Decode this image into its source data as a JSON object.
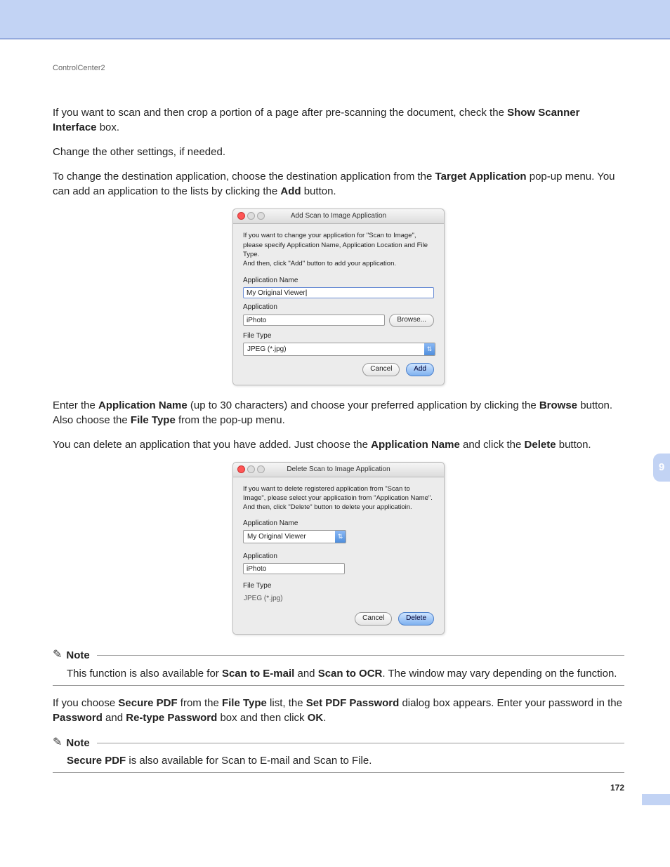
{
  "header": {
    "title": "ControlCenter2"
  },
  "chapter_tab": "9",
  "page_number": "172",
  "para1": {
    "t1": "If you want to scan and then crop a portion of a page after pre-scanning the document, check the ",
    "b1": "Show Scanner Interface",
    "t2": " box."
  },
  "para2": "Change the other settings, if needed.",
  "para3": {
    "t1": "To change the destination application, choose the destination application from the ",
    "b1": "Target Application",
    "t2": " pop-up menu. You can add an application to the lists by clicking the ",
    "b2": "Add",
    "t3": " button."
  },
  "dlg1": {
    "title": "Add Scan to Image Application",
    "instr": "If you want to change your application for \"Scan to Image\", please specify Application Name, Application Location and File Type.\nAnd then, click \"Add\" button to add your application.",
    "appname_label": "Application Name",
    "appname_value": "My Original Viewer",
    "app_label": "Application",
    "app_value": "iPhoto",
    "browse": "Browse...",
    "filetype_label": "File Type",
    "filetype_value": "JPEG (*.jpg)",
    "cancel": "Cancel",
    "add": "Add"
  },
  "para4": {
    "t1": "Enter the ",
    "b1": "Application Name",
    "t2": " (up to 30 characters) and choose your preferred application by clicking the ",
    "b2": "Browse",
    "t3": " button. Also choose the ",
    "b3": "File Type",
    "t4": " from the pop-up menu."
  },
  "para5": {
    "t1": "You can delete an application that you have added. Just choose the ",
    "b1": "Application Name",
    "t2": " and click the ",
    "b2": "Delete",
    "t3": " button."
  },
  "dlg2": {
    "title": "Delete Scan to Image Application",
    "instr": "If you want to delete registered application from \"Scan to Image\", please select your applicatioin from \"Application Name\".\nAnd then, click \"Delete\" button to delete your applicatioin.",
    "appname_label": "Application Name",
    "appname_value": "My Original Viewer",
    "app_label": "Application",
    "app_value": "iPhoto",
    "filetype_label": "File Type",
    "filetype_value": "JPEG (*.jpg)",
    "cancel": "Cancel",
    "delete": "Delete"
  },
  "note1": {
    "label": "Note",
    "t1": "This function is also available for ",
    "b1": "Scan to E-mail",
    "t2": " and ",
    "b2": "Scan to OCR",
    "t3": ". The window may vary depending on the function."
  },
  "para6": {
    "t1": "If you choose ",
    "b1": "Secure PDF",
    "t2": " from the ",
    "b2": "File Type",
    "t3": " list, the ",
    "b3": "Set PDF Password",
    "t4": " dialog box appears. Enter your password in the ",
    "b4": "Password",
    "t5": " and ",
    "b5": "Re-type Password",
    "t6": " box and then click ",
    "b6": "OK",
    "t7": "."
  },
  "note2": {
    "label": "Note",
    "b1": "Secure PDF",
    "t1": " is also available for Scan to E-mail and Scan to File."
  }
}
